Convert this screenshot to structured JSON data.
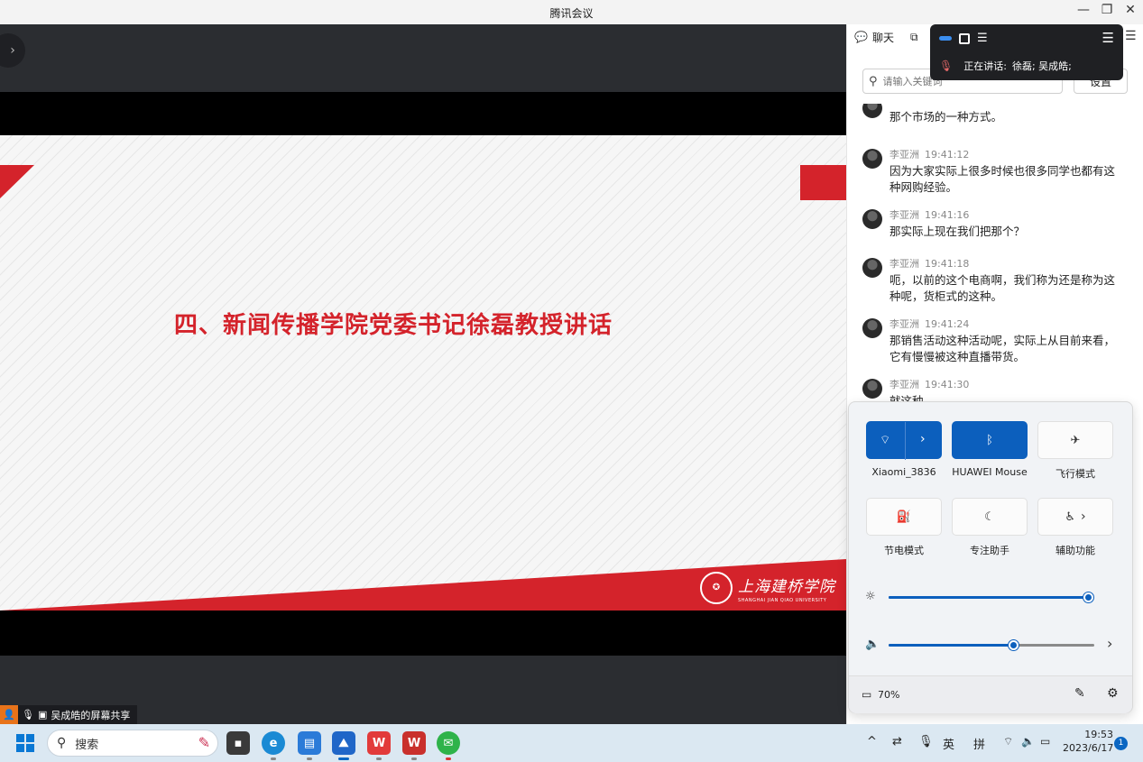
{
  "window": {
    "title": "腾讯会议",
    "minimize": "—",
    "restore": "❐",
    "close": "✕"
  },
  "stage": {
    "toggle_icon": "›",
    "slide_heading": "四、新闻传播学院党委书记徐磊教授讲话",
    "logo_cn": "上海建桥学院",
    "logo_en": "SHANGHAI JIAN QIAO UNIVERSITY",
    "share_label": "吴成皓的屏幕共享",
    "brand_red": "#d4232b"
  },
  "chat": {
    "tab_chat": "聊天",
    "search_placeholder": "请输入关键词",
    "settings_label": "设置",
    "messages": [
      {
        "sender": "",
        "time": "",
        "text": "那个市场的一种方式。"
      },
      {
        "sender": "李亚洲",
        "time": "19:41:12",
        "text": "因为大家实际上很多时候也很多同学也都有这种网购经验。"
      },
      {
        "sender": "李亚洲",
        "time": "19:41:16",
        "text": "那实际上现在我们把那个？"
      },
      {
        "sender": "李亚洲",
        "time": "19:41:18",
        "text": "呃，以前的这个电商啊，我们称为还是称为这种呢，货柜式的这种。"
      },
      {
        "sender": "李亚洲",
        "time": "19:41:24",
        "text": "那销售活动这种活动呢，实际上从目前来看，它有慢慢被这种直播带货。"
      },
      {
        "sender": "李亚洲",
        "time": "19:41:30",
        "text": "就这种"
      }
    ]
  },
  "floatbar": {
    "speaking_label": "正在讲话:",
    "speakers": "徐磊; 吴成皓;"
  },
  "quick_settings": {
    "wifi_label": "Xiaomi_3836",
    "bluetooth_label": "HUAWEI Mouse",
    "airplane_label": "飞行模式",
    "battery_saver_label": "节电模式",
    "focus_label": "专注助手",
    "accessibility_label": "辅助功能",
    "brightness": 1.0,
    "volume": 0.61,
    "battery_text": "70%",
    "accent": "#0c5fbd"
  },
  "taskbar": {
    "search_label": "搜索",
    "ime_lang": "英",
    "ime_mode": "拼",
    "time": "19:53",
    "date": "2023/6/17",
    "notification_count": "1"
  }
}
